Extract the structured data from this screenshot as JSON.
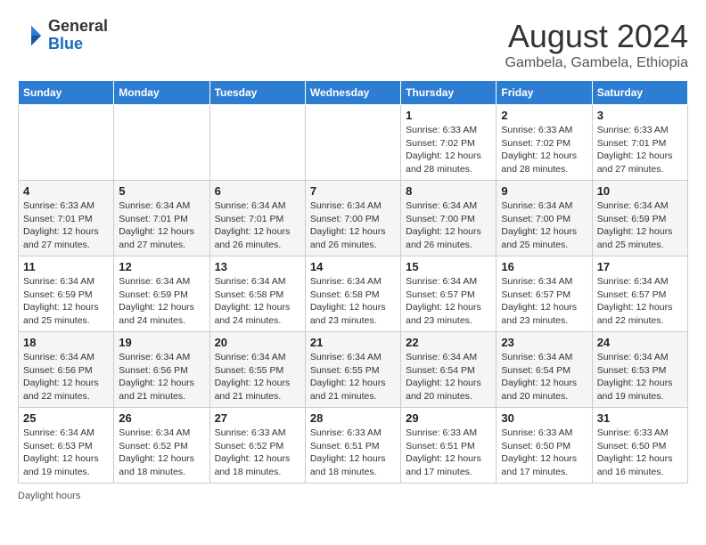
{
  "header": {
    "logo_general": "General",
    "logo_blue": "Blue",
    "month_year": "August 2024",
    "location": "Gambela, Gambela, Ethiopia"
  },
  "weekdays": [
    "Sunday",
    "Monday",
    "Tuesday",
    "Wednesday",
    "Thursday",
    "Friday",
    "Saturday"
  ],
  "weeks": [
    [
      {
        "day": "",
        "info": ""
      },
      {
        "day": "",
        "info": ""
      },
      {
        "day": "",
        "info": ""
      },
      {
        "day": "",
        "info": ""
      },
      {
        "day": "1",
        "info": "Sunrise: 6:33 AM\nSunset: 7:02 PM\nDaylight: 12 hours\nand 28 minutes."
      },
      {
        "day": "2",
        "info": "Sunrise: 6:33 AM\nSunset: 7:02 PM\nDaylight: 12 hours\nand 28 minutes."
      },
      {
        "day": "3",
        "info": "Sunrise: 6:33 AM\nSunset: 7:01 PM\nDaylight: 12 hours\nand 27 minutes."
      }
    ],
    [
      {
        "day": "4",
        "info": "Sunrise: 6:33 AM\nSunset: 7:01 PM\nDaylight: 12 hours\nand 27 minutes."
      },
      {
        "day": "5",
        "info": "Sunrise: 6:34 AM\nSunset: 7:01 PM\nDaylight: 12 hours\nand 27 minutes."
      },
      {
        "day": "6",
        "info": "Sunrise: 6:34 AM\nSunset: 7:01 PM\nDaylight: 12 hours\nand 26 minutes."
      },
      {
        "day": "7",
        "info": "Sunrise: 6:34 AM\nSunset: 7:00 PM\nDaylight: 12 hours\nand 26 minutes."
      },
      {
        "day": "8",
        "info": "Sunrise: 6:34 AM\nSunset: 7:00 PM\nDaylight: 12 hours\nand 26 minutes."
      },
      {
        "day": "9",
        "info": "Sunrise: 6:34 AM\nSunset: 7:00 PM\nDaylight: 12 hours\nand 25 minutes."
      },
      {
        "day": "10",
        "info": "Sunrise: 6:34 AM\nSunset: 6:59 PM\nDaylight: 12 hours\nand 25 minutes."
      }
    ],
    [
      {
        "day": "11",
        "info": "Sunrise: 6:34 AM\nSunset: 6:59 PM\nDaylight: 12 hours\nand 25 minutes."
      },
      {
        "day": "12",
        "info": "Sunrise: 6:34 AM\nSunset: 6:59 PM\nDaylight: 12 hours\nand 24 minutes."
      },
      {
        "day": "13",
        "info": "Sunrise: 6:34 AM\nSunset: 6:58 PM\nDaylight: 12 hours\nand 24 minutes."
      },
      {
        "day": "14",
        "info": "Sunrise: 6:34 AM\nSunset: 6:58 PM\nDaylight: 12 hours\nand 23 minutes."
      },
      {
        "day": "15",
        "info": "Sunrise: 6:34 AM\nSunset: 6:57 PM\nDaylight: 12 hours\nand 23 minutes."
      },
      {
        "day": "16",
        "info": "Sunrise: 6:34 AM\nSunset: 6:57 PM\nDaylight: 12 hours\nand 23 minutes."
      },
      {
        "day": "17",
        "info": "Sunrise: 6:34 AM\nSunset: 6:57 PM\nDaylight: 12 hours\nand 22 minutes."
      }
    ],
    [
      {
        "day": "18",
        "info": "Sunrise: 6:34 AM\nSunset: 6:56 PM\nDaylight: 12 hours\nand 22 minutes."
      },
      {
        "day": "19",
        "info": "Sunrise: 6:34 AM\nSunset: 6:56 PM\nDaylight: 12 hours\nand 21 minutes."
      },
      {
        "day": "20",
        "info": "Sunrise: 6:34 AM\nSunset: 6:55 PM\nDaylight: 12 hours\nand 21 minutes."
      },
      {
        "day": "21",
        "info": "Sunrise: 6:34 AM\nSunset: 6:55 PM\nDaylight: 12 hours\nand 21 minutes."
      },
      {
        "day": "22",
        "info": "Sunrise: 6:34 AM\nSunset: 6:54 PM\nDaylight: 12 hours\nand 20 minutes."
      },
      {
        "day": "23",
        "info": "Sunrise: 6:34 AM\nSunset: 6:54 PM\nDaylight: 12 hours\nand 20 minutes."
      },
      {
        "day": "24",
        "info": "Sunrise: 6:34 AM\nSunset: 6:53 PM\nDaylight: 12 hours\nand 19 minutes."
      }
    ],
    [
      {
        "day": "25",
        "info": "Sunrise: 6:34 AM\nSunset: 6:53 PM\nDaylight: 12 hours\nand 19 minutes."
      },
      {
        "day": "26",
        "info": "Sunrise: 6:34 AM\nSunset: 6:52 PM\nDaylight: 12 hours\nand 18 minutes."
      },
      {
        "day": "27",
        "info": "Sunrise: 6:33 AM\nSunset: 6:52 PM\nDaylight: 12 hours\nand 18 minutes."
      },
      {
        "day": "28",
        "info": "Sunrise: 6:33 AM\nSunset: 6:51 PM\nDaylight: 12 hours\nand 18 minutes."
      },
      {
        "day": "29",
        "info": "Sunrise: 6:33 AM\nSunset: 6:51 PM\nDaylight: 12 hours\nand 17 minutes."
      },
      {
        "day": "30",
        "info": "Sunrise: 6:33 AM\nSunset: 6:50 PM\nDaylight: 12 hours\nand 17 minutes."
      },
      {
        "day": "31",
        "info": "Sunrise: 6:33 AM\nSunset: 6:50 PM\nDaylight: 12 hours\nand 16 minutes."
      }
    ]
  ],
  "footer": {
    "note": "Daylight hours"
  }
}
